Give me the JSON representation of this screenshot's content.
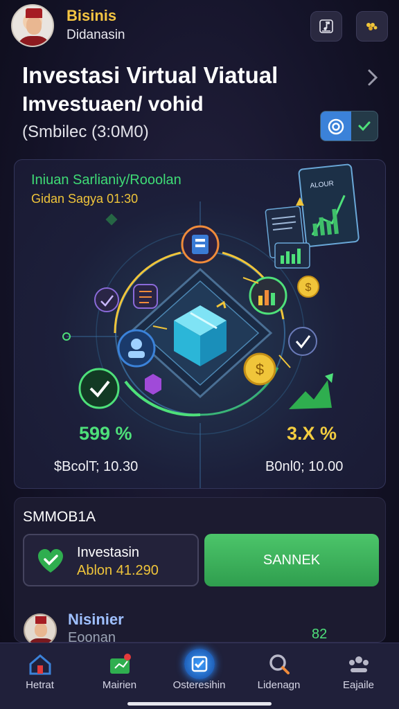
{
  "header": {
    "brand": "Bisinis",
    "subtitle": "Didanasin",
    "icons": [
      "music-note-icon",
      "coins-icon"
    ]
  },
  "titles": {
    "line1": "Investasi Virtual Viatual",
    "line2": "Imvestuaen/ vohid",
    "line3": "(Smbilec (3:0M0)"
  },
  "hero": {
    "label1": "Iniuan Sarlianiy/Rooolan",
    "label2": "Gidan Sagya 01:30",
    "chart_badge": "ALOUR",
    "percent_left": "599 %",
    "percent_right": "3.X %",
    "value_left": "$BcolT; 10.30",
    "value_right": "B0nl0; 10.00"
  },
  "summary": {
    "title": "SMMOB1A",
    "card_line1": "Investasin",
    "card_line2": "Ablon 41.290",
    "cta_label": "SANNEK"
  },
  "user": {
    "name": "Nisinier",
    "sub": "Eoonan",
    "number": "82"
  },
  "nav": {
    "items": [
      {
        "label": "Hetrat",
        "icon": "home-icon"
      },
      {
        "label": "Mairien",
        "icon": "wallet-icon"
      },
      {
        "label": "Osteresihin",
        "icon": "checklist-icon"
      },
      {
        "label": "Lidenagn",
        "icon": "search-icon"
      },
      {
        "label": "Eajaile",
        "icon": "profile-icon"
      }
    ]
  },
  "colors": {
    "accent_green": "#4ee07a",
    "accent_gold": "#f0c53a",
    "accent_blue": "#3b82d9",
    "background": "#15142a"
  }
}
